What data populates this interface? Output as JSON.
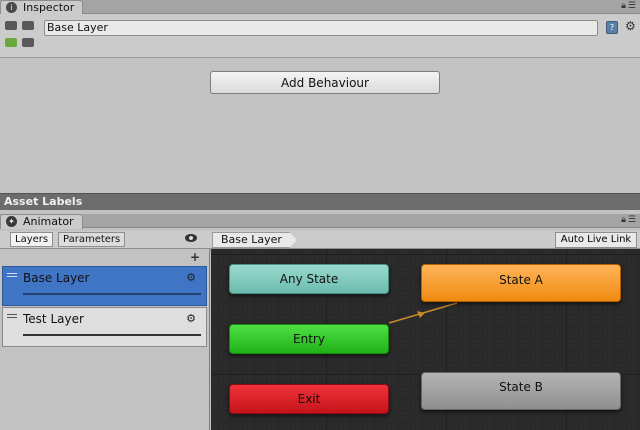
{
  "inspector": {
    "tab_label": "Inspector",
    "name_value": "Base Layer",
    "add_behaviour_label": "Add Behaviour"
  },
  "asset_labels": {
    "label": "Asset Labels"
  },
  "animator": {
    "tab_label": "Animator",
    "side_tabs": [
      "Layers",
      "Parameters"
    ],
    "plus_label": "+",
    "breadcrumb": "Base Layer",
    "auto_live_label": "Auto Live Link",
    "layers": [
      {
        "name": "Base Layer",
        "selected": true
      },
      {
        "name": "Test Layer",
        "selected": false
      }
    ],
    "states": {
      "any_state": "Any State",
      "entry": "Entry",
      "exit": "Exit",
      "state_a": "State A",
      "state_b": "State B"
    }
  },
  "colors": {
    "any_state": "#7fcdc0",
    "entry": "#2fc527",
    "exit": "#dd1f25",
    "state_a_default": "#f59a22",
    "state_b": "#a0a0a0",
    "selected_layer": "#3f75c4",
    "transition": "#c88a2a"
  },
  "icons": {
    "tab_icon": "info-circle-icon",
    "lock": "lock-icon",
    "menu": "menu-icon",
    "help": "help-book-icon",
    "settings": "gear-icon",
    "visibility": "eye-icon",
    "drag": "drag-handle-icon"
  }
}
